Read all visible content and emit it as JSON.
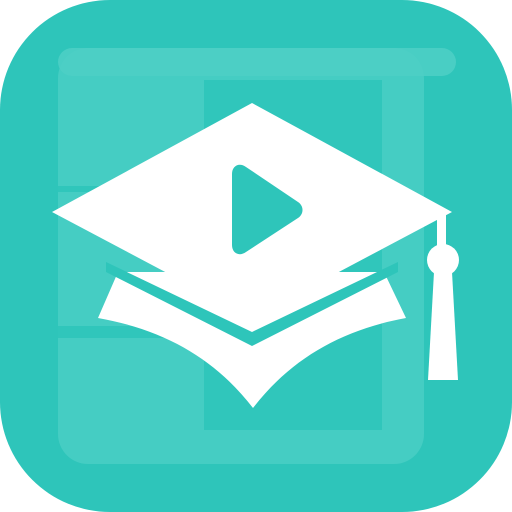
{
  "app_icon": {
    "background_color": "#2EC5BA",
    "panel_color": "#4ECFC5",
    "panel_color_light": "#5BD3C9",
    "foreground_color": "#FFFFFF",
    "play_color": "#2EC5BA",
    "symbol_icons": [
      "graduation-cap-icon",
      "play-icon"
    ]
  }
}
